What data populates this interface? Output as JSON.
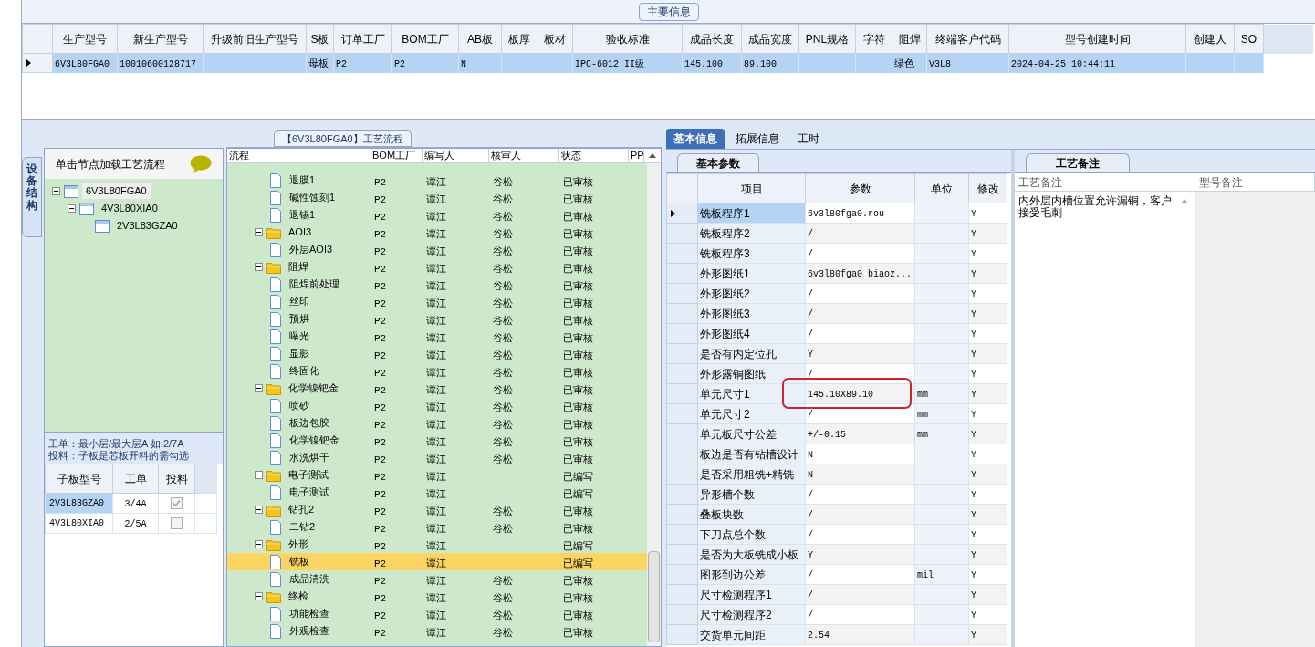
{
  "main_info": {
    "legend": "主要信息",
    "columns": [
      "生产型号",
      "新生产型号",
      "升级前旧生产型号",
      "S板",
      "订单工厂",
      "BOM工厂",
      "AB板",
      "板厚",
      "板材",
      "验收标准",
      "成品长度",
      "成品宽度",
      "PNL规格",
      "字符",
      "阻焊",
      "终端客户代码",
      "型号创建时间",
      "创建人",
      "SO"
    ],
    "rows": [
      {
        "selected": true,
        "cells": [
          "6V3L80FGA0",
          "10010600128717",
          null,
          "母板",
          "P2",
          "P2",
          "N",
          null,
          null,
          "IPC-6012 II级",
          "145.100",
          "89.100",
          null,
          null,
          "绿色",
          "V3L8",
          "2024-04-25 10:44:11",
          null,
          null
        ]
      }
    ]
  },
  "structure": {
    "side_tab": "设备结构",
    "hint": "单击节点加载工艺流程",
    "tree": [
      {
        "name": "6V3L80FGA0",
        "selected": true,
        "expanded": true,
        "children": [
          {
            "name": "4V3L80XIA0",
            "selected": false,
            "expanded": true,
            "children": [
              {
                "name": "2V3L83GZA0",
                "selected": false
              }
            ]
          }
        ]
      }
    ],
    "notes": [
      "工单：最小层/最大层A 如:2/7A",
      "投料：子板是芯板开料的需勾选"
    ],
    "columns": [
      "子板型号",
      "工单",
      "投料"
    ],
    "rows": [
      {
        "name": "2V3L83GZA0",
        "order": "3/4A",
        "checked": true,
        "selected": true
      },
      {
        "name": "4V3L80XIA0",
        "order": "2/5A",
        "checked": false,
        "selected": false
      }
    ]
  },
  "process": {
    "title": "【6V3L80FGA0】工艺流程",
    "columns": [
      "流程",
      "BOM工厂",
      "编写人",
      "核审人",
      "状态",
      "PP"
    ],
    "nodes": [
      {
        "kind": "continued",
        "children": [
          {
            "kind": "file",
            "name": "退膜1",
            "bom": "P2",
            "writer": "谭江",
            "reviewer": "谷松",
            "status": "已审核",
            "selected": false
          },
          {
            "kind": "file",
            "name": "碱性蚀刻1",
            "bom": "P2",
            "writer": "谭江",
            "reviewer": "谷松",
            "status": "已审核",
            "selected": false
          },
          {
            "kind": "file",
            "name": "退锡1",
            "bom": "P2",
            "writer": "谭江",
            "reviewer": "谷松",
            "status": "已审核",
            "selected": false
          }
        ]
      },
      {
        "kind": "folder",
        "name": "AOI3",
        "bom": "P2",
        "writer": "谭江",
        "reviewer": "谷松",
        "status": "已审核",
        "expanded": true,
        "selected": false,
        "children": [
          {
            "kind": "file",
            "name": "外层AOI3",
            "bom": "P2",
            "writer": "谭江",
            "reviewer": "谷松",
            "status": "已审核",
            "selected": false
          }
        ]
      },
      {
        "kind": "folder",
        "name": "阻焊",
        "bom": "P2",
        "writer": "谭江",
        "reviewer": "谷松",
        "status": "已审核",
        "expanded": true,
        "selected": false,
        "children": [
          {
            "kind": "file",
            "name": "阻焊前处理",
            "bom": "P2",
            "writer": "谭江",
            "reviewer": "谷松",
            "status": "已审核",
            "selected": false
          },
          {
            "kind": "file",
            "name": "丝印",
            "bom": "P2",
            "writer": "谭江",
            "reviewer": "谷松",
            "status": "已审核",
            "selected": false
          },
          {
            "kind": "file",
            "name": "预烘",
            "bom": "P2",
            "writer": "谭江",
            "reviewer": "谷松",
            "status": "已审核",
            "selected": false
          },
          {
            "kind": "file",
            "name": "曝光",
            "bom": "P2",
            "writer": "谭江",
            "reviewer": "谷松",
            "status": "已审核",
            "selected": false
          },
          {
            "kind": "file",
            "name": "显影",
            "bom": "P2",
            "writer": "谭江",
            "reviewer": "谷松",
            "status": "已审核",
            "selected": false
          },
          {
            "kind": "file",
            "name": "终固化",
            "bom": "P2",
            "writer": "谭江",
            "reviewer": "谷松",
            "status": "已审核",
            "selected": false
          }
        ]
      },
      {
        "kind": "folder",
        "name": "化学镍钯金",
        "bom": "P2",
        "writer": "谭江",
        "reviewer": "谷松",
        "status": "已审核",
        "expanded": true,
        "selected": false,
        "children": [
          {
            "kind": "file",
            "name": "喷砂",
            "bom": "P2",
            "writer": "谭江",
            "reviewer": "谷松",
            "status": "已审核",
            "selected": false
          },
          {
            "kind": "file",
            "name": "板边包胶",
            "bom": "P2",
            "writer": "谭江",
            "reviewer": "谷松",
            "status": "已审核",
            "selected": false
          },
          {
            "kind": "file",
            "name": "化学镍钯金",
            "bom": "P2",
            "writer": "谭江",
            "reviewer": "谷松",
            "status": "已审核",
            "selected": false
          },
          {
            "kind": "file",
            "name": "水洗烘干",
            "bom": "P2",
            "writer": "谭江",
            "reviewer": "谷松",
            "status": "已审核",
            "selected": false
          }
        ]
      },
      {
        "kind": "folder",
        "name": "电子测试",
        "bom": "P2",
        "writer": "谭江",
        "status": "已编写",
        "expanded": true,
        "selected": false,
        "children": [
          {
            "kind": "file",
            "name": "电子测试",
            "bom": "P2",
            "writer": "谭江",
            "status": "已编写",
            "selected": false
          }
        ]
      },
      {
        "kind": "folder",
        "name": "钻孔2",
        "bom": "P2",
        "writer": "谭江",
        "reviewer": "谷松",
        "status": "已审核",
        "expanded": true,
        "selected": false,
        "children": [
          {
            "kind": "file",
            "name": "二钻2",
            "bom": "P2",
            "writer": "谭江",
            "reviewer": "谷松",
            "status": "已审核",
            "selected": false
          }
        ]
      },
      {
        "kind": "folder",
        "name": "外形",
        "bom": "P2",
        "writer": "谭江",
        "status": "已编写",
        "expanded": true,
        "selected": false,
        "children": [
          {
            "kind": "file",
            "name": "铣板",
            "bom": "P2",
            "writer": "谭江",
            "status": "已编写",
            "selected": true
          },
          {
            "kind": "file",
            "name": "成品清洗",
            "bom": "P2",
            "writer": "谭江",
            "reviewer": "谷松",
            "status": "已审核",
            "selected": false
          }
        ]
      },
      {
        "kind": "folder",
        "name": "终检",
        "bom": "P2",
        "writer": "谭江",
        "reviewer": "谷松",
        "status": "已审核",
        "expanded": true,
        "selected": false,
        "children": [
          {
            "kind": "file",
            "name": "功能检查",
            "bom": "P2",
            "writer": "谭江",
            "reviewer": "谷松",
            "status": "已审核",
            "selected": false
          },
          {
            "kind": "file",
            "name": "外观检查",
            "bom": "P2",
            "writer": "谭江",
            "reviewer": "谷松",
            "status": "已审核",
            "selected": false
          }
        ]
      }
    ]
  },
  "details": {
    "tabs": [
      {
        "label": "基本信息",
        "selected": true
      },
      {
        "label": "拓展信息",
        "selected": false
      },
      {
        "label": "工时",
        "selected": false
      }
    ],
    "sub_tab": "基本参数",
    "columns": [
      "项目",
      "参数",
      "单位",
      "修改"
    ],
    "rows": [
      {
        "item": "铣板程序1",
        "value": "6v3l80fga0.rou",
        "modified": "Y",
        "selected": true,
        "highlighted": false
      },
      {
        "item": "铣板程序2",
        "value": "/",
        "modified": "Y",
        "selected": false,
        "highlighted": false
      },
      {
        "item": "铣板程序3",
        "value": "/",
        "modified": "Y",
        "selected": false,
        "highlighted": false
      },
      {
        "item": "外形图纸1",
        "value": "6v3l80fga0_biaoz...",
        "modified": "Y",
        "selected": false,
        "highlighted": false
      },
      {
        "item": "外形图纸2",
        "value": "/",
        "modified": "Y",
        "selected": false,
        "highlighted": false
      },
      {
        "item": "外形图纸3",
        "value": "/",
        "modified": "Y",
        "selected": false,
        "highlighted": false
      },
      {
        "item": "外形图纸4",
        "value": "/",
        "modified": "Y",
        "selected": false,
        "highlighted": false
      },
      {
        "item": "是否有内定位孔",
        "value": "Y",
        "modified": "Y",
        "selected": false,
        "highlighted": false
      },
      {
        "item": "外形露铜图纸",
        "value": "/",
        "modified": "Y",
        "selected": false,
        "highlighted": false
      },
      {
        "item": "单元尺寸1",
        "value": "145.10X89.10",
        "unit": "mm",
        "modified": "Y",
        "selected": false,
        "highlighted": true
      },
      {
        "item": "单元尺寸2",
        "value": "/",
        "unit": "mm",
        "modified": "Y",
        "selected": false,
        "highlighted": false
      },
      {
        "item": "单元板尺寸公差",
        "value": "+/-0.15",
        "unit": "mm",
        "modified": "Y",
        "selected": false,
        "highlighted": false
      },
      {
        "item": "板边是否有钻槽设计",
        "value": "N",
        "modified": "Y",
        "selected": false,
        "highlighted": false
      },
      {
        "item": "是否采用粗铣+精铣",
        "value": "N",
        "modified": "Y",
        "selected": false,
        "highlighted": false
      },
      {
        "item": "异形槽个数",
        "value": "/",
        "modified": "Y",
        "selected": false,
        "highlighted": false
      },
      {
        "item": "叠板块数",
        "value": "/",
        "modified": "Y",
        "selected": false,
        "highlighted": false
      },
      {
        "item": "下刀点总个数",
        "value": "/",
        "modified": "Y",
        "selected": false,
        "highlighted": false
      },
      {
        "item": "是否为大板铣成小板",
        "value": "Y",
        "modified": "Y",
        "selected": false,
        "highlighted": false
      },
      {
        "item": "图形到边公差",
        "value": "/",
        "unit": "mil",
        "modified": "Y",
        "selected": false,
        "highlighted": false
      },
      {
        "item": "尺寸检测程序1",
        "value": "/",
        "modified": "Y",
        "selected": false,
        "highlighted": false
      },
      {
        "item": "尺寸检测程序2",
        "value": "/",
        "modified": "Y",
        "selected": false,
        "highlighted": false
      },
      {
        "item": "交货单元间距",
        "value": "2.54",
        "modified": "Y",
        "selected": false,
        "highlighted": false
      }
    ]
  },
  "remarks": {
    "tab": "工艺备注",
    "columns": [
      "工艺备注",
      "型号备注"
    ],
    "text": "内外层内槽位置允许漏铜，客户接受毛刺"
  }
}
